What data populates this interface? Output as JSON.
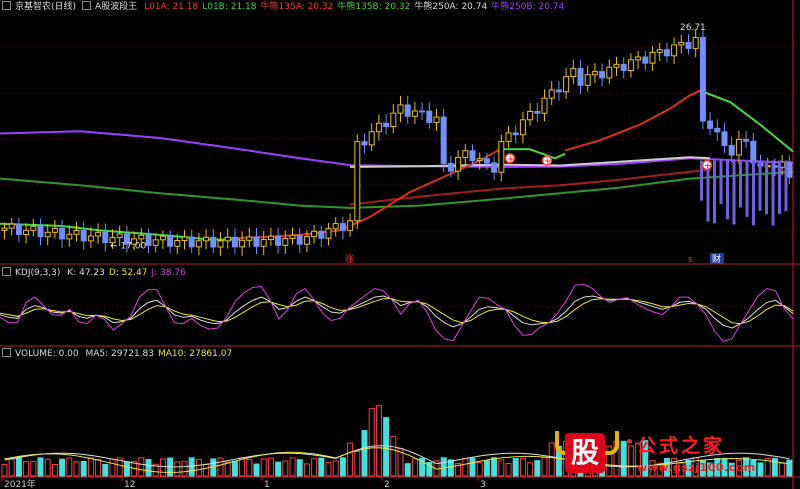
{
  "chart_data": [
    {
      "type": "candlestick",
      "header": {
        "stock": "京基智农(日线)",
        "indicator": "A股波段王",
        "legend": [
          {
            "label": "L01A: 21.18",
            "color": "#ff3333"
          },
          {
            "label": "L01B: 21.18",
            "color": "#33dd33"
          },
          {
            "label": "牛熊135A: 20.32",
            "color": "#ff3333"
          },
          {
            "label": "牛熊135B: 20.32",
            "color": "#33dd33"
          },
          {
            "label": "牛熊250A: 20.74",
            "color": "#dddddd"
          },
          {
            "label": "牛熊250B: 20.74",
            "color": "#a040ff"
          }
        ]
      },
      "ylim": [
        16.5,
        27.5
      ],
      "annotations": {
        "high": "26.71",
        "low": "17.00",
        "marker_zhang": "涨",
        "marker_cai": "财",
        "marker_s": "s"
      },
      "colors": {
        "up": "#e8c020",
        "down": "#7090ff",
        "ma_long": "#a040ff",
        "ma_green": "#2a9a2a",
        "bull_red": "#e03020",
        "bear_red": "#a02020",
        "white_line": "#cccccc"
      }
    },
    {
      "type": "line",
      "header": {
        "name": "KDJ(9,3,3)",
        "legend": [
          {
            "label": "K: 47.23",
            "color": "#dddddd"
          },
          {
            "label": "D: 52.47",
            "color": "#e8e840"
          },
          {
            "label": "J: 38.76",
            "color": "#e040e0"
          }
        ]
      },
      "series": [
        {
          "name": "K",
          "values": [
            45,
            40,
            38,
            55,
            62,
            58,
            50,
            48,
            52,
            42,
            38,
            44,
            40,
            30,
            32,
            38,
            56,
            68,
            72,
            60,
            45,
            40,
            42,
            35,
            30,
            28,
            35,
            50,
            62,
            72,
            78,
            70,
            55,
            58,
            70,
            78,
            72,
            60,
            50,
            48,
            55,
            62,
            70,
            78,
            80,
            74,
            62,
            68,
            70,
            60,
            42,
            30,
            22,
            28,
            40,
            55,
            60,
            58,
            55,
            42,
            30,
            26,
            28,
            30,
            38,
            52,
            70,
            78,
            80,
            76,
            72,
            74,
            75,
            70,
            65,
            60,
            55,
            60,
            68,
            70,
            65,
            55,
            38,
            25,
            20,
            28,
            40,
            55,
            68,
            72,
            60,
            47
          ]
        },
        {
          "name": "D",
          "values": [
            48,
            45,
            42,
            48,
            55,
            56,
            53,
            50,
            51,
            47,
            43,
            44,
            42,
            37,
            34,
            36,
            45,
            55,
            62,
            60,
            52,
            46,
            44,
            40,
            36,
            32,
            33,
            40,
            50,
            60,
            68,
            69,
            64,
            60,
            63,
            70,
            71,
            66,
            58,
            53,
            54,
            58,
            64,
            70,
            75,
            75,
            70,
            69,
            69,
            65,
            55,
            45,
            35,
            30,
            34,
            44,
            52,
            55,
            55,
            50,
            42,
            35,
            31,
            30,
            33,
            42,
            55,
            66,
            73,
            75,
            74,
            74,
            74,
            72,
            69,
            65,
            60,
            60,
            63,
            66,
            65,
            60,
            50,
            40,
            30,
            28,
            33,
            43,
            55,
            63,
            62,
            52
          ]
        },
        {
          "name": "J",
          "values": [
            40,
            30,
            30,
            68,
            78,
            62,
            45,
            44,
            55,
            32,
            28,
            44,
            36,
            16,
            28,
            42,
            78,
            92,
            92,
            60,
            30,
            28,
            38,
            25,
            18,
            20,
            40,
            70,
            86,
            96,
            98,
            72,
            37,
            54,
            84,
            94,
            74,
            48,
            34,
            38,
            57,
            70,
            82,
            94,
            90,
            72,
            46,
            66,
            72,
            50,
            16,
            0,
            -4,
            24,
            52,
            78,
            76,
            64,
            55,
            26,
            6,
            8,
            22,
            30,
            48,
            72,
            100,
            102,
            94,
            78,
            68,
            74,
            77,
            66,
            57,
            50,
            45,
            60,
            78,
            78,
            65,
            45,
            14,
            -5,
            0,
            28,
            54,
            80,
            94,
            90,
            56,
            37
          ]
        }
      ]
    },
    {
      "type": "bar",
      "header": {
        "name": "VOLUME: 0.00",
        "legend": [
          {
            "label": "MA5: 29721.83",
            "color": "#dddddd"
          },
          {
            "label": "MA10: 27861.07",
            "color": "#e8e840"
          }
        ]
      },
      "x_tick_labels": [
        "2021年",
        "12",
        "1",
        "2",
        "3"
      ],
      "ylim": [
        0,
        100
      ],
      "up_color": "#ff4040",
      "down_color": "#40e0e0"
    }
  ],
  "watermark": {
    "logo": "股",
    "title": "公式之家",
    "url": "www.gszj100.com"
  }
}
